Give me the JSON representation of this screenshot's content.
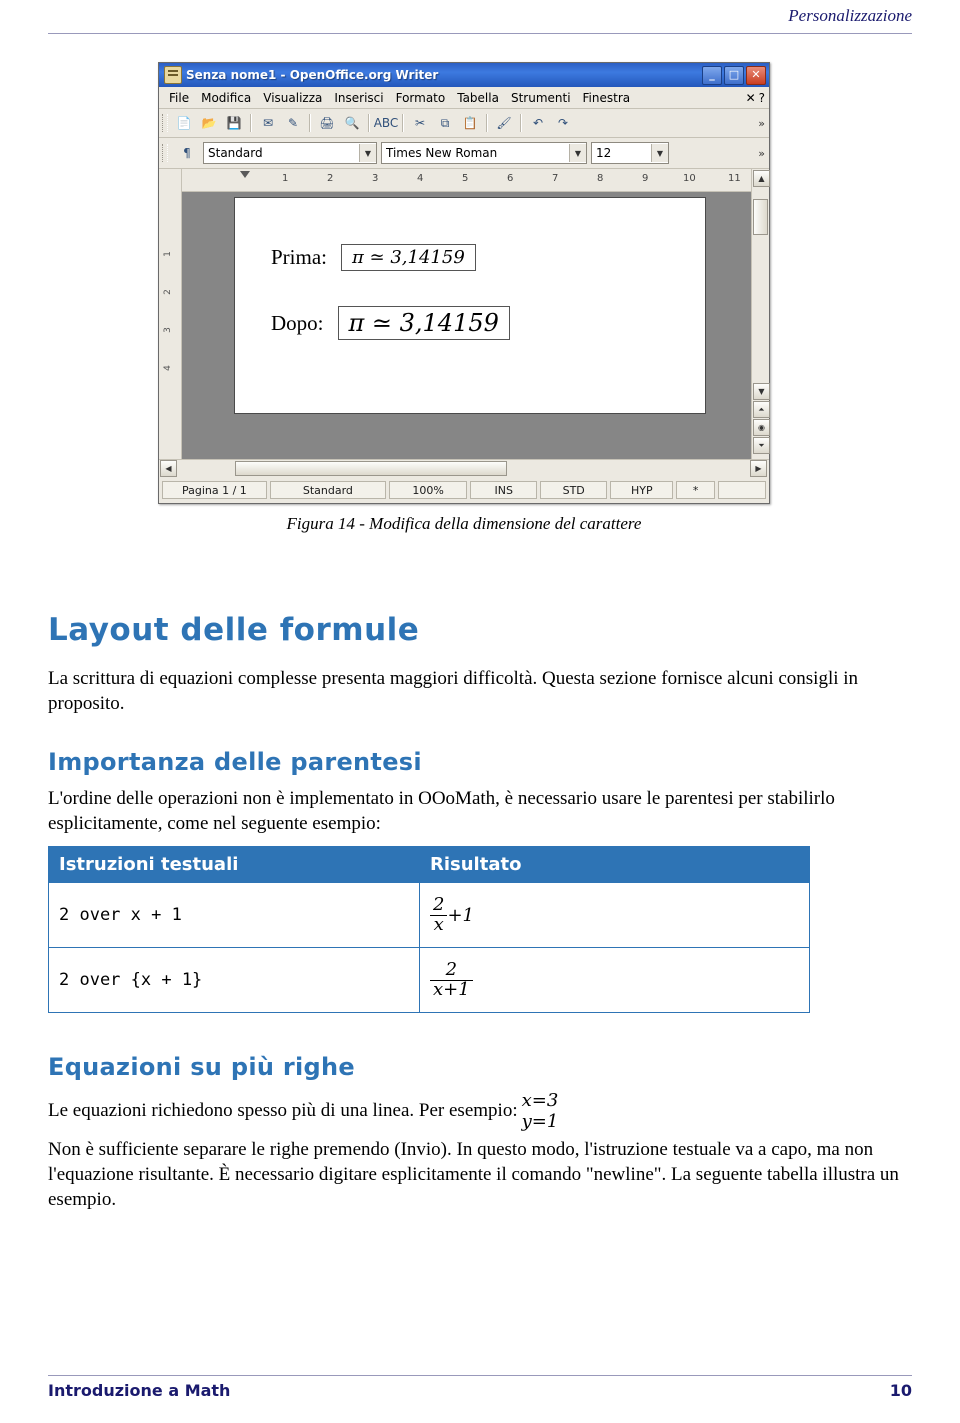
{
  "header": {
    "running_title": "Personalizzazione"
  },
  "figure": {
    "window": {
      "title": "Senza nome1 - OpenOffice.org Writer",
      "title_icon": "writer-document-icon",
      "buttons": {
        "minimize": "_",
        "maximize": "□",
        "close": "✕"
      },
      "menu": [
        "File",
        "Modifica",
        "Visualizza",
        "Inserisci",
        "Formato",
        "Tabella",
        "Strumenti",
        "Finestra"
      ],
      "menu_right": [
        "✕",
        "?"
      ],
      "format_bar": {
        "paragraph_style": "Standard",
        "font_name": "Times New Roman",
        "font_size": "12"
      },
      "ruler_h_labels": [
        "1",
        "2",
        "3",
        "4",
        "5",
        "6",
        "7",
        "8",
        "9",
        "10",
        "11"
      ],
      "ruler_v_labels": [
        "1",
        "2",
        "3",
        "4"
      ],
      "document": {
        "row1_label": "Prima:",
        "row1_formula": "π ≃ 3,14159",
        "row2_label": "Dopo:",
        "row2_formula": "π ≃ 3,14159"
      },
      "status": [
        "Pagina 1 / 1",
        "Standard",
        "100%",
        "INS",
        "STD",
        "HYP",
        "*",
        ""
      ]
    },
    "caption": "Figura 14 - Modifica della dimensione del carattere"
  },
  "content": {
    "section_title": "Layout delle formule",
    "intro_paragraph": "La scrittura di equazioni complesse presenta maggiori difficoltà. Questa sezione fornisce alcuni consigli in proposito.",
    "sub1_title": "Importanza delle parentesi",
    "sub1_paragraph": "L'ordine delle operazioni non è implementato in OOoMath, è necessario usare le parentesi per stabilirlo esplicitamente, come nel seguente esempio:",
    "table": {
      "headers": [
        "Istruzioni testuali",
        "Risultato"
      ],
      "rows": [
        {
          "code": "2 over x + 1",
          "result": {
            "numerator": "2",
            "denominator": "x",
            "suffix": "+1"
          }
        },
        {
          "code": "2 over {x + 1}",
          "result": {
            "numerator": "2",
            "denominator": "x+1",
            "suffix": ""
          }
        }
      ]
    },
    "sub2_title": "Equazioni su più righe",
    "sub2_paragraph_before": "Le equazioni richiedono spesso più di una linea. Per esempio:",
    "sub2_equation": {
      "line1": "x=3",
      "line2": "y=1"
    },
    "sub2_paragraph_after": "Non è sufficiente separare le righe premendo (Invio). In questo modo, l'istruzione testuale va a capo, ma non l'equazione risultante. È necessario digitare esplicitamente il comando \"newline\". La seguente tabella illustra un esempio."
  },
  "footer": {
    "left": "Introduzione a Math",
    "right": "10"
  },
  "colors": {
    "accent": "#2e74b5",
    "header_text": "#1a1a6e",
    "titlebar": "#2b5fc4"
  }
}
